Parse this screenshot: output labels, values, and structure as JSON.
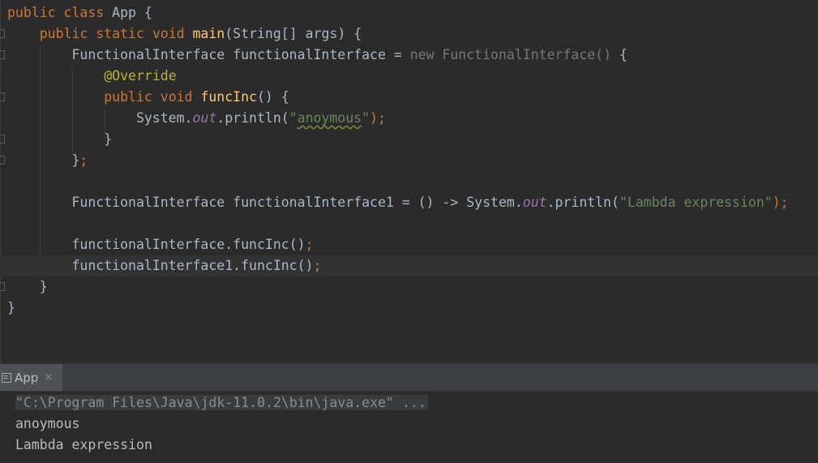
{
  "editor": {
    "lines": [
      {
        "tokens": [
          {
            "t": "public class ",
            "c": "kw"
          },
          {
            "t": "App {",
            "c": ""
          }
        ]
      },
      {
        "tokens": [
          {
            "t": "    ",
            "c": ""
          },
          {
            "t": "public static void ",
            "c": "kw"
          },
          {
            "t": "main",
            "c": "fn"
          },
          {
            "t": "(String[] args) {",
            "c": ""
          }
        ]
      },
      {
        "tokens": [
          {
            "t": "        FunctionalInterface functionalInterface = ",
            "c": ""
          },
          {
            "t": "new FunctionalInterface()",
            "c": "dim"
          },
          {
            "t": " {",
            "c": ""
          }
        ]
      },
      {
        "tokens": [
          {
            "t": "            ",
            "c": ""
          },
          {
            "t": "@Override",
            "c": "ann"
          }
        ]
      },
      {
        "tokens": [
          {
            "t": "            ",
            "c": ""
          },
          {
            "t": "public void ",
            "c": "kw"
          },
          {
            "t": "funcInc",
            "c": "fn"
          },
          {
            "t": "() {",
            "c": ""
          }
        ]
      },
      {
        "tokens": [
          {
            "t": "                System.",
            "c": ""
          },
          {
            "t": "out",
            "c": "fld"
          },
          {
            "t": ".println(",
            "c": ""
          },
          {
            "t": "\"",
            "c": "str"
          },
          {
            "t": "anoymous",
            "c": "str typo"
          },
          {
            "t": "\"",
            "c": "str"
          },
          {
            "t": ");",
            "c": "kw"
          }
        ]
      },
      {
        "tokens": [
          {
            "t": "            }",
            "c": ""
          }
        ]
      },
      {
        "tokens": [
          {
            "t": "        }",
            "c": ""
          },
          {
            "t": ";",
            "c": "kw"
          }
        ]
      },
      {
        "tokens": []
      },
      {
        "tokens": [
          {
            "t": "        FunctionalInterface functionalInterface1 = () -> System.",
            "c": ""
          },
          {
            "t": "out",
            "c": "fld"
          },
          {
            "t": ".println(",
            "c": ""
          },
          {
            "t": "\"Lambda expression\"",
            "c": "str"
          },
          {
            "t": ");",
            "c": "kw"
          }
        ]
      },
      {
        "tokens": []
      },
      {
        "tokens": [
          {
            "t": "        functionalInterface.funcInc()",
            "c": ""
          },
          {
            "t": ";",
            "c": "kw"
          }
        ]
      },
      {
        "tokens": [
          {
            "t": "        functionalInterface1.funcInc()",
            "c": ""
          },
          {
            "t": ";",
            "c": "kw"
          }
        ],
        "current": true
      },
      {
        "tokens": [
          {
            "t": "    }",
            "c": ""
          }
        ]
      },
      {
        "tokens": [
          {
            "t": "}",
            "c": ""
          }
        ]
      }
    ]
  },
  "run_panel": {
    "tab_label": "App",
    "tab_close": "×",
    "console_lines": [
      "\"C:\\Program Files\\Java\\jdk-11.0.2\\bin\\java.exe\" ...",
      "anoymous",
      "Lambda expression"
    ]
  },
  "colors": {
    "background": "#2b2b2b",
    "keyword": "#cc7832",
    "method": "#ffc66d",
    "string": "#6a8759",
    "annotation": "#bbb529",
    "field": "#9876aa",
    "text": "#a9b7c6"
  }
}
